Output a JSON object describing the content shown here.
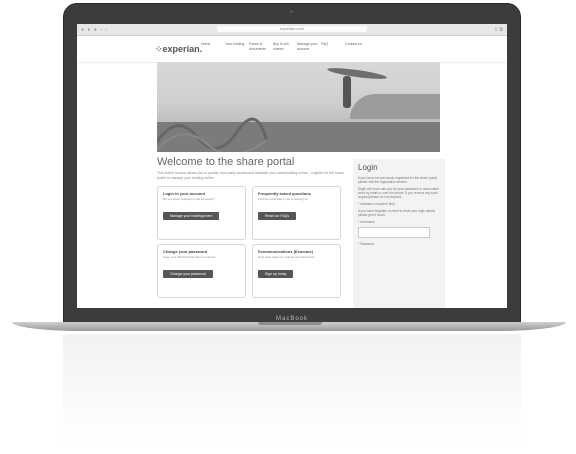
{
  "browser": {
    "url": "experian.com"
  },
  "site": {
    "logo": "experian.",
    "nav": [
      "Home",
      "Your holding",
      "Forms & documents",
      "Buy & sell shares",
      "Manage your account",
      "FAQ",
      "Contact us"
    ],
    "title": "Welcome to the share portal",
    "intro": "This online service allows you to quickly and easily access and maintain your shareholding online – register for the share portal to manage your holding online.",
    "cards": [
      {
        "heading": "Login to your account",
        "text": "Do you have holdings in the company?",
        "button": "Manage your holdings here"
      },
      {
        "heading": "Frequently asked questions",
        "text": "Find the information you're looking for",
        "button": "Read our FAQs"
      },
      {
        "heading": "Change your password",
        "text": "Keep your Share Portal account secure",
        "button": "Change your password"
      },
      {
        "heading": "Ecommunications (Ecomms)",
        "text": "Help save paper by signing up to Ecomms",
        "button": "Sign up today"
      }
    ],
    "login": {
      "title": "Login",
      "p1": "If you have not previously registered for the share portal please visit the registration section.",
      "p2": "Digits will never ask you for your password or memorable word by email or over the phone. If you receive any such request please do not respond.",
      "p3": "* indicates a required field",
      "p4": "If you have forgotten or need to reset your login details please get in touch.",
      "username_label": "* Username",
      "password_label": "* Password"
    }
  },
  "laptop": {
    "brand": "MacBook"
  }
}
